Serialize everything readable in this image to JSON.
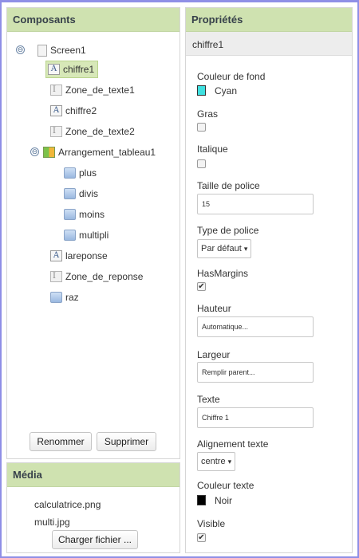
{
  "components_panel": {
    "title": "Composants",
    "tree": [
      {
        "label": "Screen1",
        "icon": "screen-icon"
      },
      {
        "label": "chiffre1",
        "icon": "label-icon",
        "selected": true
      },
      {
        "label": "Zone_de_texte1",
        "icon": "textbox-icon"
      },
      {
        "label": "chiffre2",
        "icon": "label-icon"
      },
      {
        "label": "Zone_de_texte2",
        "icon": "textbox-icon"
      },
      {
        "label": "Arrangement_tableau1",
        "icon": "table-arrangement-icon"
      },
      {
        "label": "plus",
        "icon": "button-icon"
      },
      {
        "label": "divis",
        "icon": "button-icon"
      },
      {
        "label": "moins",
        "icon": "button-icon"
      },
      {
        "label": "multipli",
        "icon": "button-icon"
      },
      {
        "label": "lareponse",
        "icon": "label-icon"
      },
      {
        "label": "Zone_de_reponse",
        "icon": "textbox-icon"
      },
      {
        "label": "raz",
        "icon": "button-icon"
      }
    ],
    "rename_label": "Renommer",
    "delete_label": "Supprimer"
  },
  "media_panel": {
    "title": "Média",
    "files": [
      "calculatrice.png",
      "multi.jpg"
    ],
    "upload_label": "Charger fichier ..."
  },
  "properties_panel": {
    "title": "Propriétés",
    "component_name": "chiffre1",
    "background_color_label": "Couleur de fond",
    "background_color_value": "Cyan",
    "background_color_hex": "#3fe0e0",
    "bold_label": "Gras",
    "bold_checked": false,
    "italic_label": "Italique",
    "italic_checked": false,
    "font_size_label": "Taille de police",
    "font_size_value": "15",
    "font_type_label": "Type de police",
    "font_type_value": "Par défaut",
    "has_margins_label": "HasMargins",
    "has_margins_checked": true,
    "height_label": "Hauteur",
    "height_value": "Automatique...",
    "width_label": "Largeur",
    "width_value": "Remplir parent...",
    "text_label": "Texte",
    "text_value": "Chiffre 1",
    "text_align_label": "Alignement texte",
    "text_align_value": "centre",
    "text_color_label": "Couleur texte",
    "text_color_value": "Noir",
    "text_color_hex": "#000000",
    "visible_label": "Visible",
    "visible_checked": true
  },
  "glyphs": {
    "collapse": "⊖",
    "check": "✔",
    "caret": "▾",
    "label_icon": "A",
    "textbox_icon": "I"
  }
}
